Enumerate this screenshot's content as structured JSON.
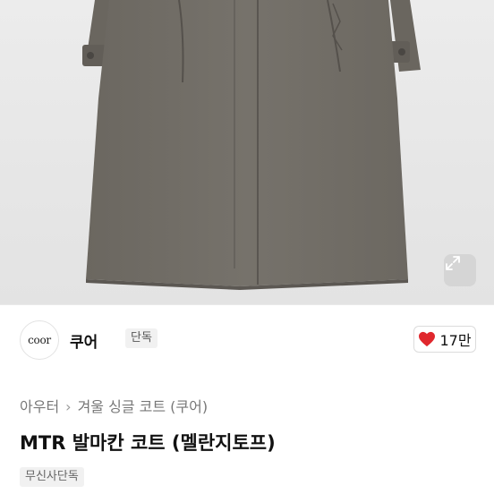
{
  "product_image": {
    "alt_desc": "",
    "expand_icon": "expand-arrows-icon"
  },
  "brand": {
    "logo_text": "coor",
    "name": "쿠어",
    "badge": "단독"
  },
  "like": {
    "icon": "heart-icon",
    "color": "#e0272d",
    "count": "17만"
  },
  "breadcrumb": {
    "items": [
      "아우터",
      "겨울 싱글 코트 (쿠어)"
    ]
  },
  "product": {
    "title": "MTR 발마칸 코트 (멜란지토프)",
    "tag": "무신사단독"
  }
}
